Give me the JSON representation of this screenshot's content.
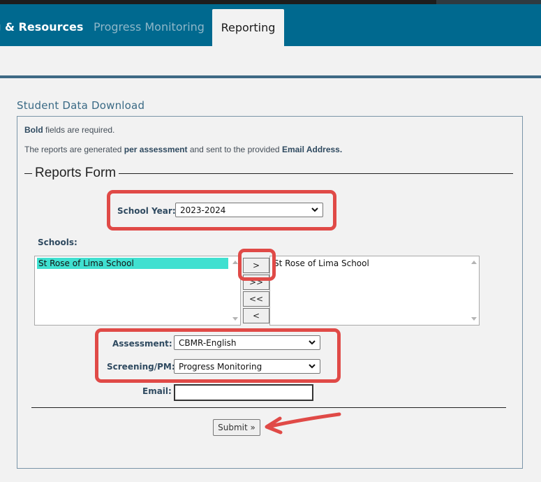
{
  "nav": {
    "tabs": [
      {
        "label": "g & Resources"
      },
      {
        "label": "Progress Monitoring"
      },
      {
        "label": "Reporting"
      }
    ],
    "active_tab": "Reporting"
  },
  "section_title": "Student Data Download",
  "notes": {
    "required_bold": "Bold",
    "required_rest": " fields are required.",
    "reports_pre": "The reports are generated ",
    "reports_bold1": "per assessment",
    "reports_mid": " and sent to the provided ",
    "reports_bold2": "Email Address."
  },
  "form": {
    "legend": "Reports Form",
    "school_year": {
      "label": "School Year:",
      "value": "2023-2024"
    },
    "schools": {
      "label": "Schools:",
      "available": [
        "St Rose of Lima School"
      ],
      "selected": [
        "St Rose of Lima School"
      ],
      "buttons": {
        "add": ">",
        "add_all": ">>",
        "remove_all": "<<",
        "remove": "<"
      }
    },
    "assessment": {
      "label": "Assessment:",
      "value": "CBMR-English"
    },
    "screening": {
      "label": "Screening/PM:",
      "value": "Progress Monitoring"
    },
    "email": {
      "label": "Email:",
      "value": ""
    },
    "submit": "Submit »"
  },
  "colors": {
    "nav_bg": "#00698f",
    "highlight": "#e04a47",
    "list_selection": "#40e0d0",
    "title": "#3a6a85"
  }
}
